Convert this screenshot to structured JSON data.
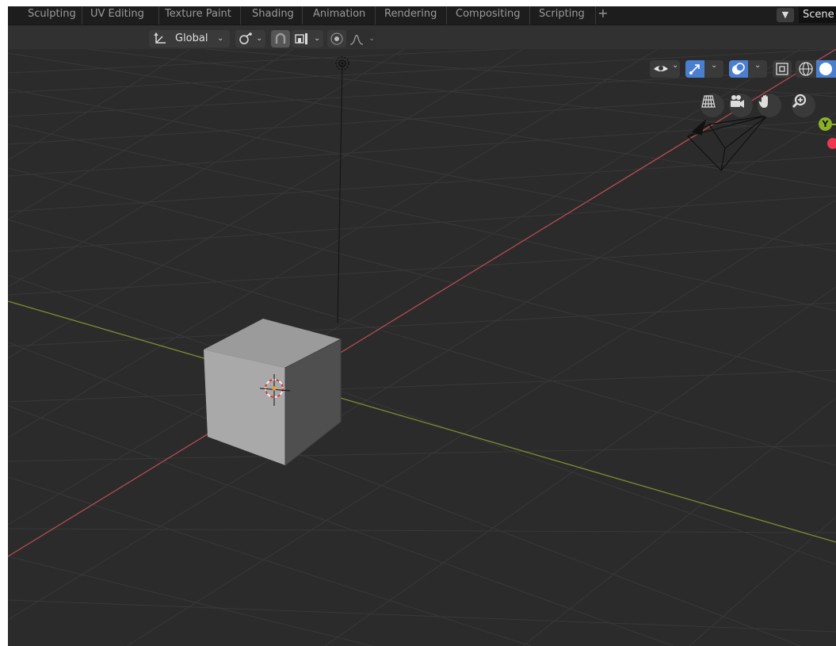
{
  "workspaces": [
    "Sculpting",
    "UV Editing",
    "Texture Paint",
    "Shading",
    "Animation",
    "Rendering",
    "Compositing",
    "Scripting"
  ],
  "add_workspace": "+",
  "scene_label": "Scene",
  "header": {
    "orientation_label": "Global"
  },
  "gizmo": {
    "y_axis_label": "Y"
  },
  "colors": {
    "x_axis": "#b64a57",
    "y_axis": "#7a8f2f",
    "grid": "#383838",
    "background": "#2b2b2b",
    "accent": "#4a7fcf"
  },
  "icons": [
    "transform-orientation-icon",
    "pivot-point-icon",
    "snap-icon",
    "snap-element-icon",
    "proportional-edit-icon",
    "falloff-icon",
    "visibility-icon",
    "gizmo-icon",
    "overlay-icon",
    "xray-icon",
    "wireframe-shading-icon",
    "solid-shading-icon",
    "grid-toggle-icon",
    "camera-view-icon",
    "pan-hand-icon",
    "zoom-icon",
    "light-icon",
    "camera-object-icon",
    "3d-cursor-icon"
  ]
}
